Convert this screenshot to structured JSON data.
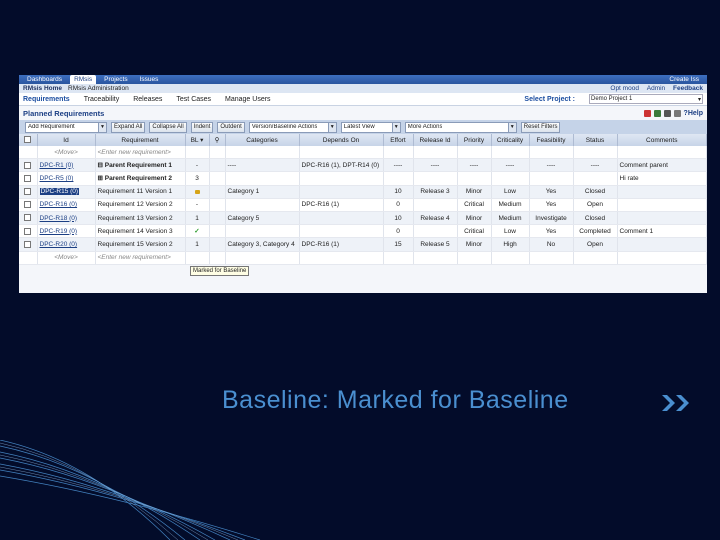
{
  "topnav": {
    "items": [
      "Dashboards",
      "RMsis",
      "Projects",
      "Issues"
    ],
    "active": 1,
    "right": "Create Iss"
  },
  "crumbs": {
    "home": "RMsis Home",
    "admin": "RMsis Administration",
    "ops": "Opt mood",
    "admin2": "Admin",
    "feedback": "Feedback"
  },
  "subnav": {
    "items": [
      "Requirements",
      "Traceability",
      "Releases",
      "Test Cases",
      "Manage Users"
    ],
    "active": 0,
    "select_label": "Select Project :",
    "project": "Demo Project 1"
  },
  "panel": {
    "title": "Planned Requirements",
    "help": "Help"
  },
  "toolbar": {
    "add": "Add Requirement",
    "expand": "Expand All",
    "collapse": "Collapse All",
    "indent": "Indent",
    "outdent": "Outdent",
    "baseline": "Version/Baseline Actions",
    "latest": "Latest View",
    "more": "More Actions",
    "reset": "Reset Filters"
  },
  "columns": [
    "",
    "Id",
    "Requirement",
    "BL",
    "",
    "Categories",
    "Depends On",
    "Effort",
    "Release Id",
    "Priority",
    "Criticality",
    "Feasibility",
    "Status",
    "Comments"
  ],
  "rows": [
    {
      "id": "<Move>",
      "req": "<Enter new requirement>",
      "bl": "",
      "cat": "",
      "dep": "",
      "effort": "",
      "rel": "",
      "pri": "",
      "crit": "",
      "feas": "",
      "status": "",
      "comm": "",
      "kind": "new"
    },
    {
      "id": "DPC-R1 (0)",
      "req": "⊟ Parent Requirement 1",
      "bl": "-",
      "cat": "----",
      "dep": "DPC-R16 (1), DPT-R14 (0)",
      "effort": "----",
      "rel": "----",
      "pri": "----",
      "crit": "----",
      "feas": "----",
      "status": "----",
      "comm": "Comment parent",
      "kind": "parent"
    },
    {
      "id": "DPC-R5 (0)",
      "req": "⊞ Parent Requirement 2",
      "bl": "3",
      "cat": "",
      "dep": "",
      "effort": "",
      "rel": "",
      "pri": "",
      "crit": "",
      "feas": "",
      "status": "",
      "comm": "Hi rate",
      "kind": "parent"
    },
    {
      "id": "DPC-R15 (0)",
      "req": "Requirement 11 Version 1",
      "bl": "lock",
      "cat": "Category 1",
      "dep": "",
      "effort": "10",
      "rel": "Release 3",
      "pri": "Minor",
      "crit": "Low",
      "feas": "Yes",
      "status": "Closed",
      "comm": "",
      "kind": "hl"
    },
    {
      "id": "DPC-R16 (0)",
      "req": "Requirement 12 Version 2",
      "bl": "-",
      "cat": "",
      "dep": "DPC-R16 (1)",
      "effort": "0",
      "rel": "",
      "pri": "Critical",
      "crit": "Medium",
      "feas": "Yes",
      "status": "Open",
      "comm": "",
      "kind": "norm"
    },
    {
      "id": "DPC-R18 (0)",
      "req": "Requirement 13 Version 2",
      "bl": "1",
      "cat": "Category 5",
      "dep": "",
      "effort": "10",
      "rel": "Release 4",
      "pri": "Minor",
      "crit": "Medium",
      "feas": "Investigate",
      "status": "Closed",
      "comm": "",
      "kind": "norm"
    },
    {
      "id": "DPC-R19 (0)",
      "req": "Requirement 14 Version 3",
      "bl": "check",
      "cat": "",
      "dep": "",
      "effort": "0",
      "rel": "",
      "pri": "Critical",
      "crit": "Low",
      "feas": "Yes",
      "status": "Completed",
      "comm": "Comment 1",
      "kind": "hl"
    },
    {
      "id": "DPC-R20 (0)",
      "req": "Requirement 15 Version 2",
      "bl": "1",
      "cat": "Category 3, Category 4",
      "dep": "DPC-R16 (1)",
      "effort": "15",
      "rel": "Release 5",
      "pri": "Minor",
      "crit": "High",
      "feas": "No",
      "status": "Open",
      "comm": "",
      "kind": "norm"
    },
    {
      "id": "<Move>",
      "req": "<Enter new requirement>",
      "bl": "",
      "cat": "",
      "dep": "",
      "effort": "",
      "rel": "",
      "pri": "",
      "crit": "",
      "feas": "",
      "status": "",
      "comm": "",
      "kind": "new"
    }
  ],
  "tooltip": "Marked for Baseline",
  "caption": "Baseline: Marked for Baseline",
  "colors": {
    "background": "#030c2a",
    "caption": "#4a8fd0",
    "accent": "#1c3f84"
  }
}
